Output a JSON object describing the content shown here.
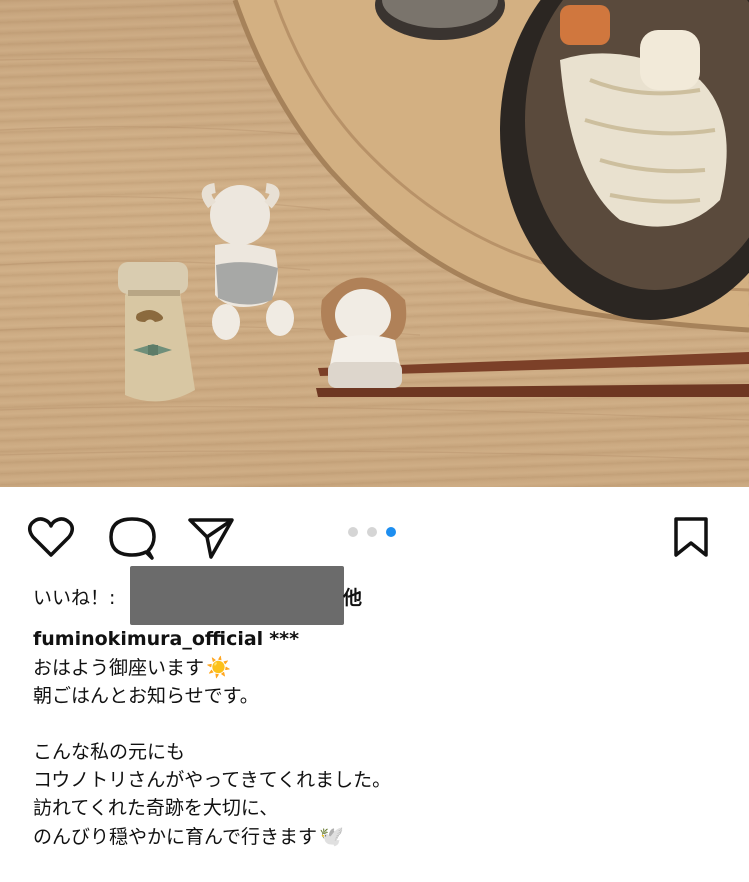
{
  "post": {
    "image_alt": "Ceramic chopstick rests (baby, mustached man, girl) beside chopsticks and a bowl of noodles on a wooden table",
    "carousel": {
      "count": 3,
      "active_index": 2
    }
  },
  "actions": {
    "like_icon": "heart-icon",
    "comment_icon": "comment-bubble-icon",
    "share_icon": "paper-plane-icon",
    "save_icon": "bookmark-icon"
  },
  "likes": {
    "label": "いいね！:",
    "suffix": "他"
  },
  "caption": {
    "username": "fuminokimura_official",
    "after_username": "***",
    "lines": [
      "おはよう御座います",
      "朝ごはんとお知らせです。",
      "",
      "こんな私の元にも",
      "コウノトリさんがやってきてくれました。",
      "訪れてくれた奇跡を大切に、",
      "のんびり穏やかに育んで行きます"
    ],
    "line1_emoji": "☀️",
    "line7_emoji": "🕊️"
  },
  "colors": {
    "accent_dot": "#1d8ef0",
    "inactive_dot": "#d5d5d5",
    "redaction": "#6b6b6b"
  }
}
